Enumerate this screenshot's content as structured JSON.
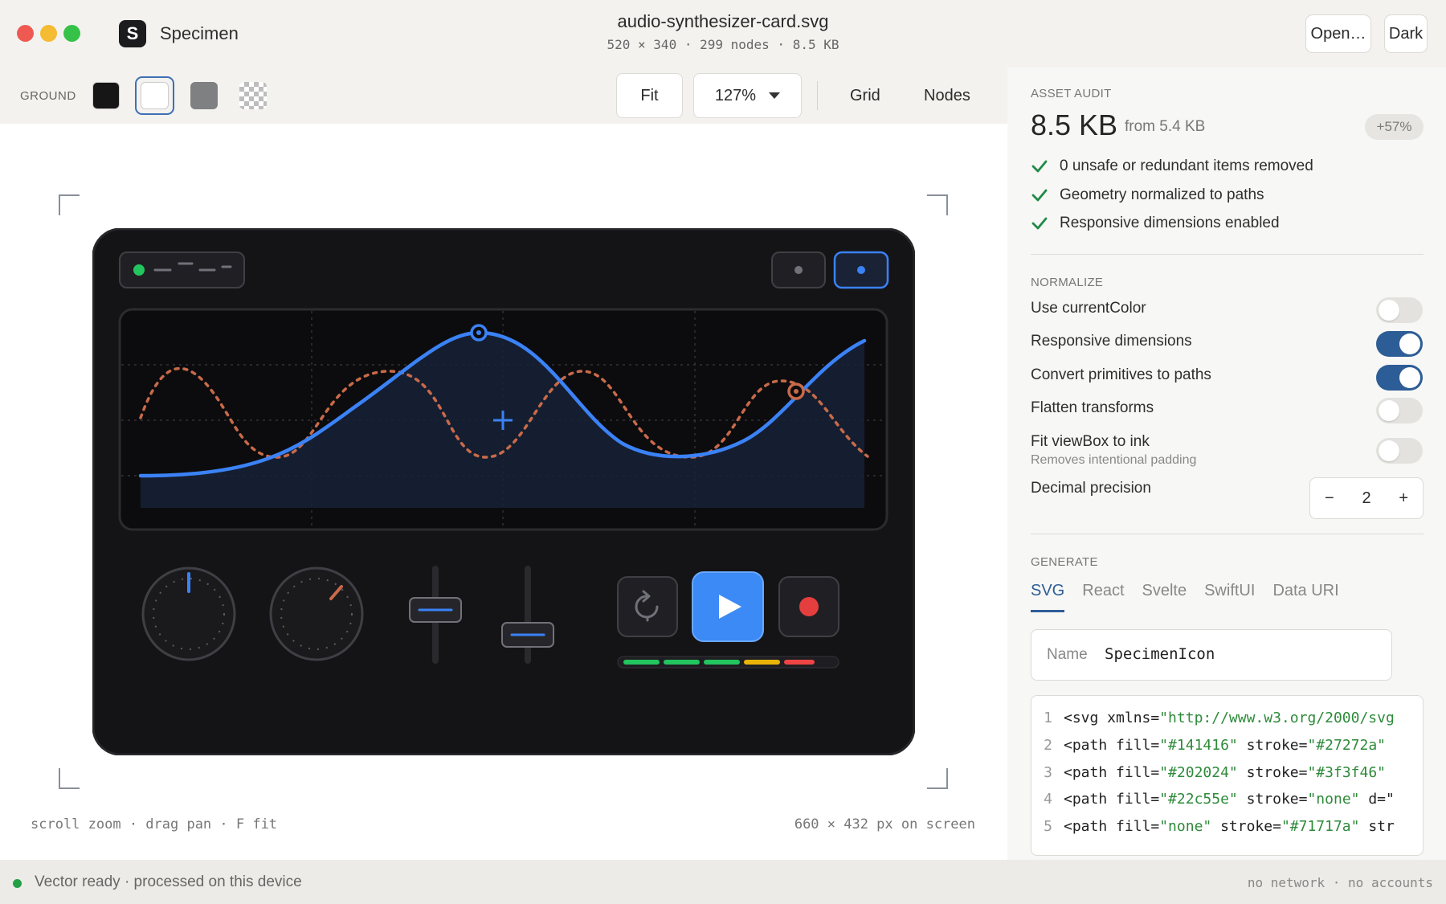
{
  "window": {
    "app_name": "Specimen",
    "app_logo_letter": "S",
    "doc_title": "audio-synthesizer-card.svg",
    "doc_meta": "520 × 340 · 299 nodes · 8.5 KB",
    "open_label": "Open…",
    "theme_label": "Dark"
  },
  "toolbar": {
    "ground_label": "GROUND",
    "ground_swatches": [
      "black",
      "white",
      "gray",
      "transparent-checker"
    ],
    "ground_selected": "white",
    "fit_label": "Fit",
    "zoom_value": "127%",
    "grid_label": "Grid",
    "nodes_label": "Nodes"
  },
  "canvas": {
    "hint": "scroll zoom  ·  drag pan  ·  F fit",
    "screen_size": "660 × 432 px on screen"
  },
  "synth": {
    "primary_wave_color": "#3b82f6",
    "secondary_wave_color": "#c86a4a",
    "meter_colors": [
      "#22c55e",
      "#22c55e",
      "#22c55e",
      "#eab308",
      "#ef4444"
    ],
    "play_button_color": "#3b8af5",
    "record_color": "#e53e3e",
    "icons": [
      "status-led-icon",
      "loop-icon",
      "play-icon",
      "record-icon"
    ]
  },
  "audit": {
    "heading": "ASSET AUDIT",
    "size": "8.5 KB",
    "from": "from 5.4 KB",
    "delta": "+57%",
    "checks": [
      "0 unsafe or redundant items removed",
      "Geometry normalized to paths",
      "Responsive dimensions enabled"
    ]
  },
  "normalize": {
    "heading": "NORMALIZE",
    "options": [
      {
        "label": "Use currentColor",
        "on": false
      },
      {
        "label": "Responsive dimensions",
        "on": true
      },
      {
        "label": "Convert primitives to paths",
        "on": true
      },
      {
        "label": "Flatten transforms",
        "on": false
      },
      {
        "label": "Fit viewBox to ink",
        "sub": "Removes intentional padding",
        "on": false
      }
    ],
    "precision_label": "Decimal precision",
    "precision_value": "2",
    "minus": "−",
    "plus": "+"
  },
  "generate": {
    "heading": "GENERATE",
    "tabs": [
      "SVG",
      "React",
      "Svelte",
      "SwiftUI",
      "Data URI"
    ],
    "active_tab": "SVG",
    "name_label": "Name",
    "name_value": "SpecimenIcon",
    "code": [
      {
        "n": "1",
        "pre": "<svg xmlns=",
        "s1": "\"http://www.w3.org/2000/svg",
        "mid": "",
        "s2": "",
        "post": ""
      },
      {
        "n": "2",
        "pre": "<path fill=",
        "s1": "\"#141416\"",
        "mid": " stroke=",
        "s2": "\"#27272a\"",
        "post": ""
      },
      {
        "n": "3",
        "pre": "<path fill=",
        "s1": "\"#202024\"",
        "mid": " stroke=",
        "s2": "\"#3f3f46\"",
        "post": ""
      },
      {
        "n": "4",
        "pre": "<path fill=",
        "s1": "\"#22c55e\"",
        "mid": " stroke=",
        "s2": "\"none\"",
        "post": " d=\""
      },
      {
        "n": "5",
        "pre": "<path fill=",
        "s1": "\"none\"",
        "mid": " stroke=",
        "s2": "\"#71717a\"",
        "post": " str"
      }
    ]
  },
  "status": {
    "text": "Vector ready · processed on this device",
    "right": "no network · no accounts"
  }
}
